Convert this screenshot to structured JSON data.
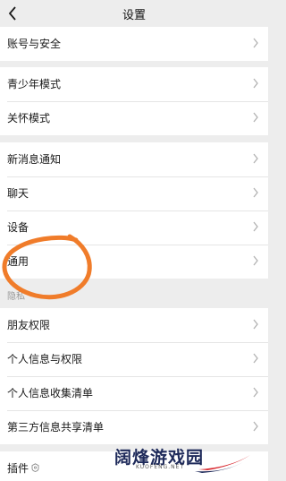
{
  "header": {
    "title": "设置",
    "back_icon": "chevron-left-icon"
  },
  "groups": [
    {
      "items": [
        {
          "label": "账号与安全"
        }
      ]
    },
    {
      "items": [
        {
          "label": "青少年模式"
        },
        {
          "label": "关怀模式"
        }
      ]
    },
    {
      "items": [
        {
          "label": "新消息通知"
        },
        {
          "label": "聊天"
        },
        {
          "label": "设备"
        },
        {
          "label": "通用"
        }
      ]
    },
    {
      "section": "隐私",
      "items": [
        {
          "label": "朋友权限"
        },
        {
          "label": "个人信息与权限"
        },
        {
          "label": "个人信息收集清单"
        },
        {
          "label": "第三方信息共享清单"
        }
      ]
    },
    {
      "items": [
        {
          "label": "插件",
          "icon": "plugin-icon"
        }
      ]
    }
  ],
  "annotation": {
    "color": "#f07c2a"
  },
  "watermark": {
    "text": "阔烽游戏园",
    "sub": "KUOFENG.NET"
  }
}
